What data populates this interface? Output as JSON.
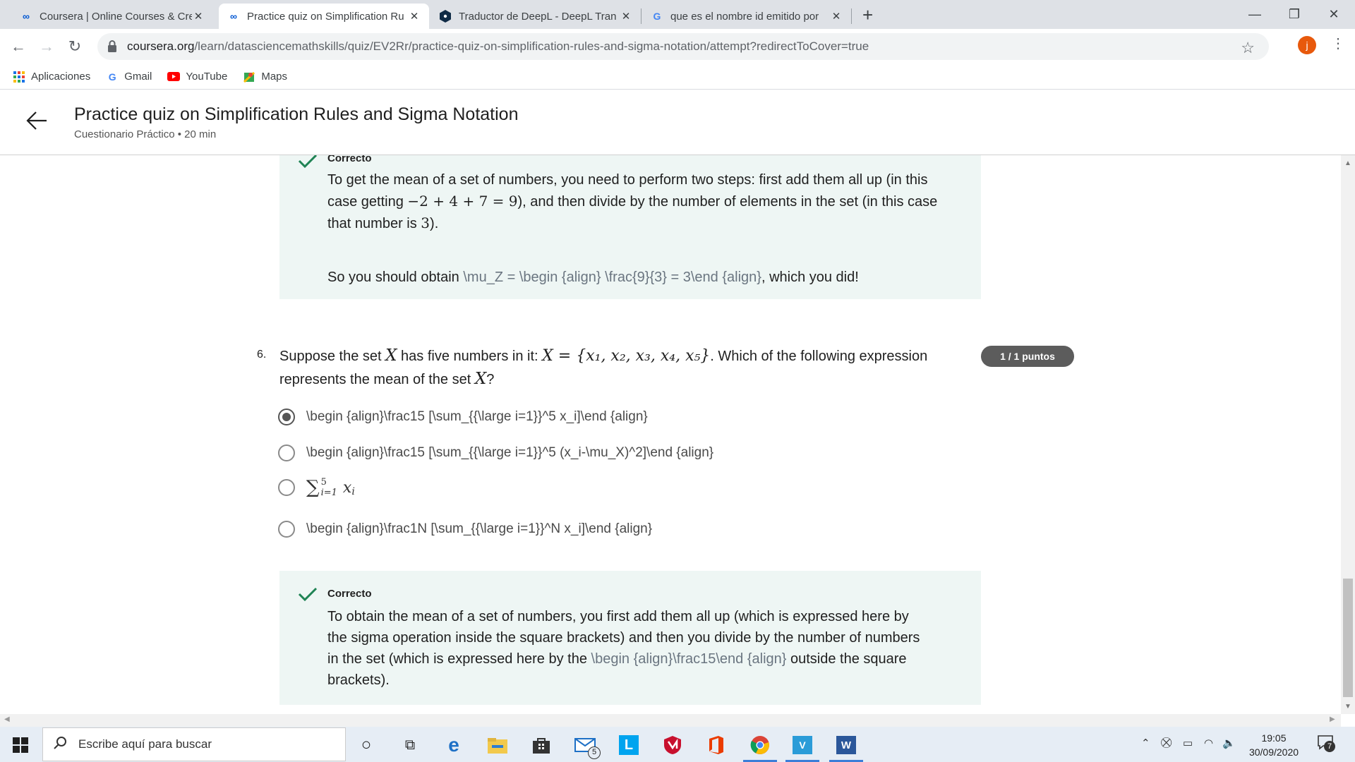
{
  "browser": {
    "tabs": [
      {
        "title": "Coursera | Online Courses & Cred",
        "icon": "coursera-icon",
        "active": false
      },
      {
        "title": "Practice quiz on Simplification Ru",
        "icon": "coursera-icon",
        "active": true
      },
      {
        "title": "Traductor de DeepL - DeepL Tran",
        "icon": "deepl-icon",
        "active": false
      },
      {
        "title": "que es el nombre id emitido por",
        "icon": "google-icon",
        "active": false
      }
    ],
    "url_host": "coursera.org",
    "url_path": "/learn/datasciencemathskills/quiz/EV2Rr/practice-quiz-on-simplification-rules-and-sigma-notation/attempt?redirectToCover=true",
    "avatar_letter": "j",
    "bookmarks": [
      "Aplicaciones",
      "Gmail",
      "YouTube",
      "Maps"
    ]
  },
  "header": {
    "title": "Practice quiz on Simplification Rules and Sigma Notation",
    "subtitle": "Cuestionario Práctico • 20 min"
  },
  "feedback5": {
    "label": "Correcto",
    "p1_a": "To get the mean of a set of numbers, you need to perform two steps: first add them all up (in this",
    "p1_b_pre": "case getting ",
    "p1_b_math": "−2 + 4 + 7 = 9",
    "p1_b_post": "), and then divide by the number of elements in the set (in this case",
    "p1_c_pre": "that number is ",
    "p1_c_math": "3",
    "p1_c_post": ").",
    "p2_pre": "So you should obtain ",
    "p2_latex": "\\mu_Z = \\begin {align} \\frac{9}{3} = 3\\end {align}",
    "p2_post": ", which you did!"
  },
  "question6": {
    "number": "6.",
    "line1_a": "Suppose the set ",
    "line1_X": "X",
    "line1_b": " has five numbers in it: ",
    "line1_math": "X = {x₁, x₂, x₃, x₄, x₅}",
    "line1_c": ". Which of the following expression",
    "line2_a": "represents the mean of the set ",
    "line2_X": "X",
    "line2_b": "?",
    "points": "1 / 1 puntos",
    "options": [
      {
        "text": "\\begin {align}\\frac15 [\\sum_{{\\large i=1}}^5 x_i]\\end {align}",
        "selected": true
      },
      {
        "text": "\\begin {align}\\frac15 [\\sum_{{\\large i=1}}^5 (x_i-\\mu_X)^2]\\end {align}",
        "selected": false
      },
      {
        "text": "∑",
        "sup": "5",
        "sub": "i=1",
        "var": "x",
        "var_sub": "i",
        "selected": false
      },
      {
        "text": "\\begin {align}\\frac1N [\\sum_{{\\large i=1}}^N x_i]\\end {align}",
        "selected": false
      }
    ]
  },
  "feedback6": {
    "label": "Correcto",
    "l1": "To obtain the mean of a set of numbers, you first add them all up (which is expressed here by",
    "l2": "the sigma operation inside the square brackets) and then you divide by the number of numbers",
    "l3_pre": "in the set (which is expressed here by the ",
    "l3_latex": "\\begin {align}\\frac15\\end {align}",
    "l3_post": " outside the square",
    "l4": "brackets)."
  },
  "taskbar": {
    "search_placeholder": "Escribe aquí para buscar",
    "mail_badge": "5",
    "time": "19:05",
    "date": "30/09/2020",
    "notif_count": "7"
  },
  "colors": {
    "accent_check": "#1f8354",
    "feedback_bg": "#eef6f4",
    "points_badge": "#5c5c5c"
  }
}
